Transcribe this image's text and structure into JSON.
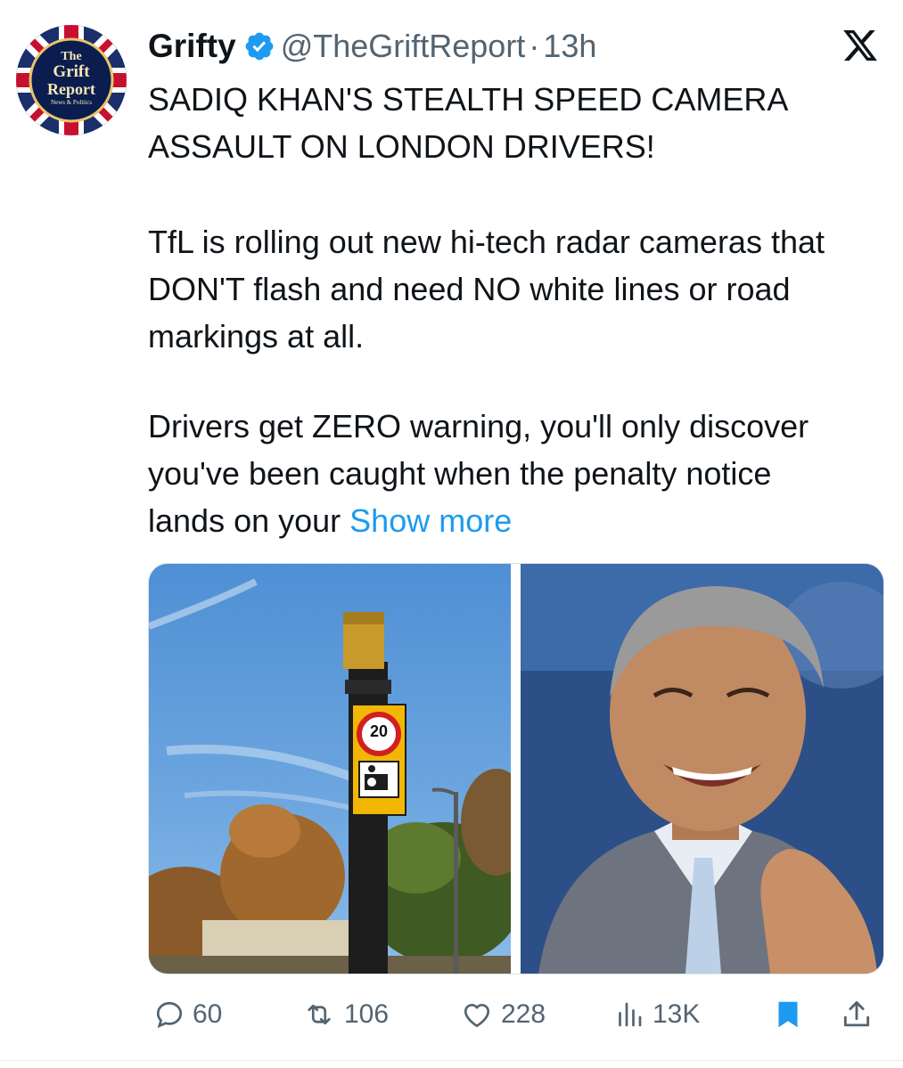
{
  "tweet": {
    "author": {
      "display_name": "Grifty",
      "handle": "@TheGriftReport",
      "separator": "·",
      "time": "13h",
      "verified": true,
      "avatar": {
        "line1": "The",
        "line2": "Grift",
        "line3": "Report",
        "line4": "News & Politics"
      }
    },
    "text": {
      "headline": "SADIQ KHAN'S STEALTH SPEED CAMERA ASSAULT ON LONDON DRIVERS!",
      "paragraph2": "TfL is rolling out new hi-tech radar cameras that DON'T flash and need NO white lines or road markings at all.",
      "paragraph3": "Drivers get ZERO warning, you'll only discover you've been caught when the penalty notice lands on your",
      "show_more": "Show more"
    },
    "media": {
      "left_image": {
        "sign_speed": "20"
      }
    },
    "actions": {
      "replies": "60",
      "reposts": "106",
      "likes": "228",
      "views": "13K"
    },
    "icons": {
      "platform": "x-logo-icon",
      "verified": "verified-badge-icon",
      "reply": "reply-icon",
      "repost": "repost-icon",
      "like": "heart-icon",
      "views": "views-chart-icon",
      "bookmark": "bookmark-icon",
      "share": "share-icon"
    },
    "colors": {
      "accent": "#1d9bf0",
      "secondary_text": "#536471",
      "primary_text": "#0f1419"
    }
  }
}
